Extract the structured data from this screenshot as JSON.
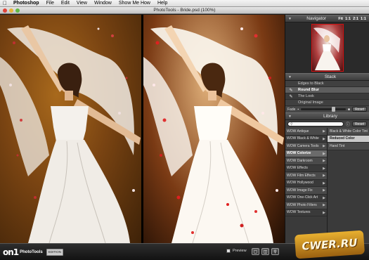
{
  "menubar": {
    "app": "Photoshop",
    "items": [
      "File",
      "Edit",
      "View",
      "Window",
      "Show Me How",
      "Help"
    ]
  },
  "window": {
    "title": "PhotoTools - Bride.psd (100%)"
  },
  "navigator": {
    "title": "Navigator",
    "zoom": [
      "Fit",
      "1:1",
      "2:1",
      "1:1"
    ]
  },
  "stack": {
    "title": "Stack",
    "items": [
      {
        "label": "Edges to Black"
      },
      {
        "label": "Round Blur"
      },
      {
        "label": "The Look"
      },
      {
        "label": "Original Image"
      }
    ],
    "fade_label": "Fade",
    "fade_value": 0.72,
    "reset_label": "Reset"
  },
  "library": {
    "title": "Library",
    "search_placeholder": "",
    "reset_label": "Reset",
    "categories": [
      "WOW Antique",
      "WOW Black & White",
      "WOW Camera Tools",
      "WOW Colorize",
      "WOW Darkroom",
      "WOW Effects",
      "WOW Film Effects",
      "WOW Hollywood",
      "WOW Image Fix",
      "WOW One-Click Art",
      "WOW Photo Filters",
      "WOW Textures"
    ],
    "selected_category": "WOW Colorize",
    "presets": [
      "Black & White Color Tint",
      "Reduced Color",
      "Hand Tint"
    ],
    "selected_preset": "Reduced Color"
  },
  "bottombar": {
    "logo": "on1",
    "product": "PhotoTools",
    "edition": "EDITION",
    "preview_label": "Preview"
  },
  "watermark": {
    "text": "CWER.RU"
  },
  "colors": {
    "selection_red": "#d01010",
    "panel_bg": "#3a3a3a",
    "panel_header": "#4a4a4a"
  }
}
